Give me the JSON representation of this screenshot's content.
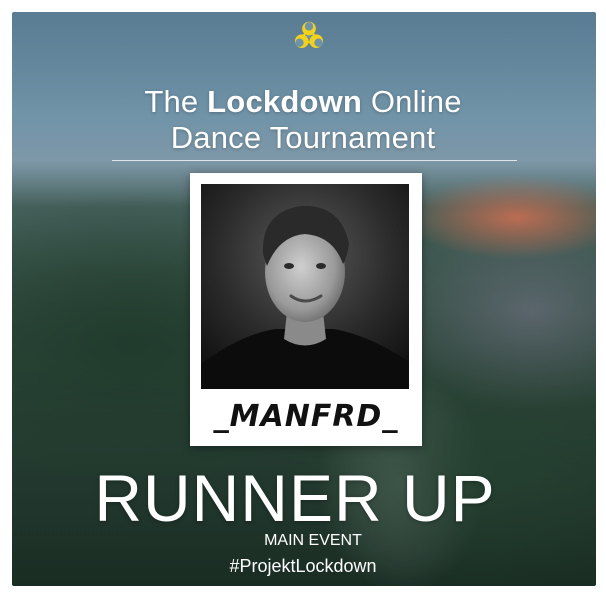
{
  "poster": {
    "icon": "biohazard-icon",
    "icon_color": "#f3d21c",
    "title_line1_pre": "The ",
    "title_line1_bold": "Lockdown",
    "title_line1_post": " Online",
    "title_line2": "Dance Tournament",
    "handle": "_MANFRD_",
    "placement": "RUNNER UP",
    "event": "MAIN EVENT",
    "hashtag": "#ProjektLockdown"
  },
  "colors": {
    "text": "#ffffff",
    "handle_text": "#111111",
    "polaroid": "#ffffff"
  }
}
